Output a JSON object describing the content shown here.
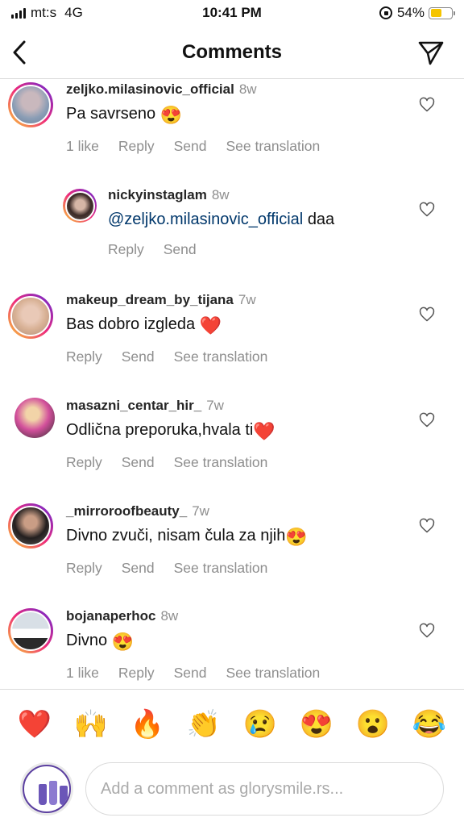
{
  "status_bar": {
    "carrier": "mt:s",
    "network": "4G",
    "time": "10:41 PM",
    "battery": "54%",
    "battery_level": 0.54,
    "battery_color": "#f5c400"
  },
  "header": {
    "title": "Comments",
    "back_icon": "chevron-left-icon",
    "share_icon": "paper-plane-icon"
  },
  "comments": [
    {
      "username": "zeljko.milasinovic_official",
      "time": "8w",
      "text": "Pa savrseno",
      "emoji": "😍",
      "like_count": "1 like",
      "reply": "Reply",
      "send": "Send",
      "translate": "See translation"
    },
    {
      "username": "nickyinstaglam",
      "time": "8w",
      "mention": "@zeljko.milasinovic_official",
      "text": "daa",
      "reply": "Reply",
      "send": "Send"
    },
    {
      "username": "makeup_dream_by_tijana",
      "time": "7w",
      "text": "Bas dobro izgleda",
      "emoji": "❤️",
      "reply": "Reply",
      "send": "Send",
      "translate": "See translation"
    },
    {
      "username": "masazni_centar_hir_",
      "time": "7w",
      "text": "Odlična preporuka,hvala ti",
      "emoji": "❤️",
      "reply": "Reply",
      "send": "Send",
      "translate": "See translation"
    },
    {
      "username": "_mirroroofbeauty_",
      "time": "7w",
      "text": "Divno zvuči, nisam čula za njih",
      "emoji": "😍",
      "reply": "Reply",
      "send": "Send",
      "translate": "See translation"
    },
    {
      "username": "bojanaperhoc",
      "time": "8w",
      "text": "Divno",
      "emoji": "😍",
      "like_count": "1 like",
      "reply": "Reply",
      "send": "Send",
      "translate": "See translation"
    }
  ],
  "emoji_bar": [
    "❤️",
    "🙌",
    "🔥",
    "👏",
    "😢",
    "😍",
    "😮",
    "😂"
  ],
  "composer": {
    "placeholder": "Add a comment as glorysmile.rs..."
  },
  "colors": {
    "mention": "#00376b",
    "secondary_text": "#8e8e8e",
    "story_ring": [
      "#f9ce34",
      "#ee2a7b",
      "#6228d7"
    ]
  }
}
